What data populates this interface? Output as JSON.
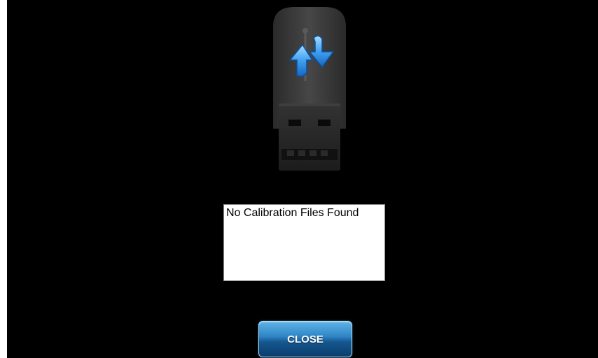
{
  "dialog": {
    "icon": "usb-sync-icon",
    "file_list": {
      "items": [
        "No Calibration Files Found"
      ]
    },
    "close_label": "CLOSE"
  },
  "colors": {
    "background": "#000000",
    "button_accent": "#2f86c6",
    "arrow_blue": "#3fa0f0"
  }
}
